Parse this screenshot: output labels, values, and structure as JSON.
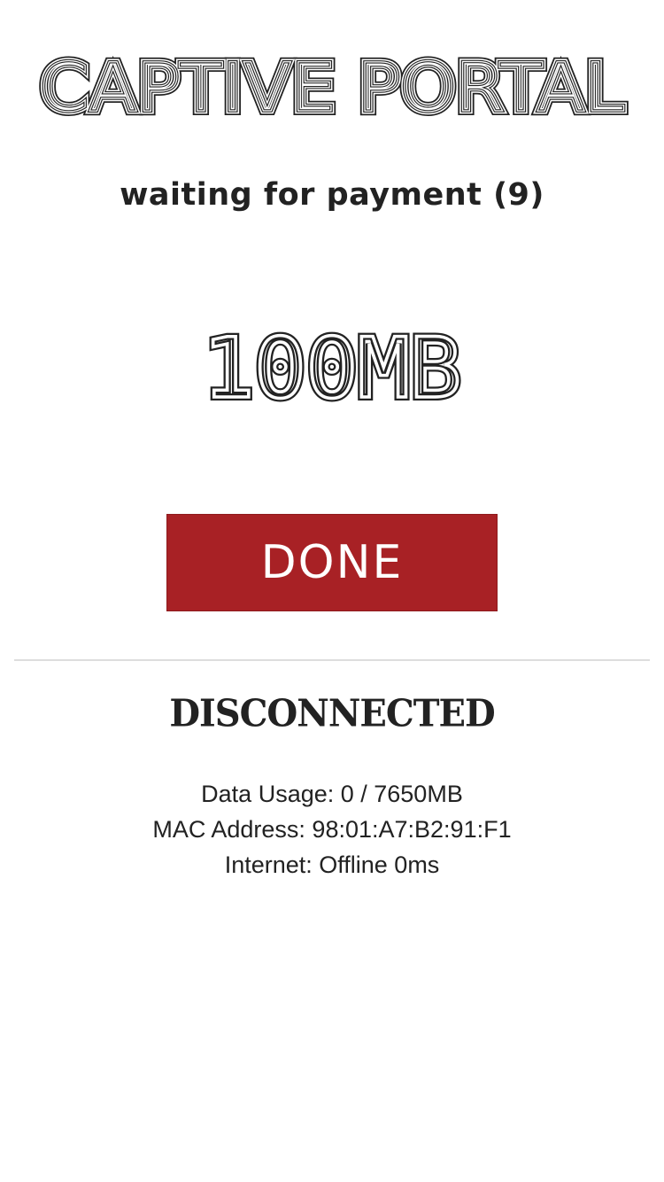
{
  "header": {
    "title": "CAPTIVE PORTAL"
  },
  "payment": {
    "status": "waiting for payment (9)",
    "amount": "100MB"
  },
  "actions": {
    "done_label": "DONE"
  },
  "connection": {
    "status": "DISCONNECTED",
    "data_usage": "Data Usage: 0 / 7650MB",
    "mac_address": "MAC Address: 98:01:A7:B2:91:F1",
    "internet": "Internet: Offline 0ms"
  },
  "colors": {
    "button_background": "#a82125",
    "text": "#222222",
    "divider": "#dddddd"
  }
}
